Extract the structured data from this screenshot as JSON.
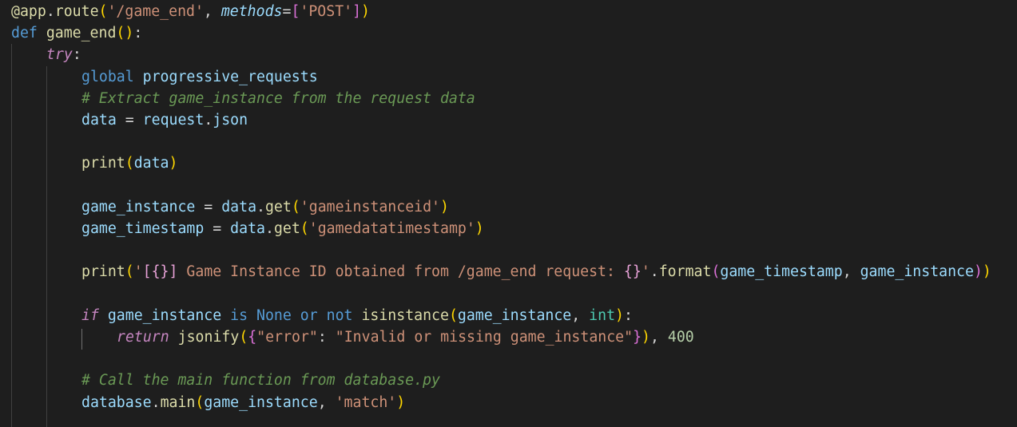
{
  "editor": {
    "theme_background": "#1e1e1e",
    "lines": [
      {
        "indent": 0,
        "tokens": [
          {
            "t": "@app",
            "c": "t-deco"
          },
          {
            "t": ".",
            "c": "t-plain"
          },
          {
            "t": "route",
            "c": "t-deco"
          },
          {
            "t": "(",
            "c": "t-b1"
          },
          {
            "t": "'/game_end'",
            "c": "t-str"
          },
          {
            "t": ", ",
            "c": "t-plain"
          },
          {
            "t": "methods",
            "c": "t-param"
          },
          {
            "t": "=",
            "c": "t-plain"
          },
          {
            "t": "[",
            "c": "t-b2"
          },
          {
            "t": "'POST'",
            "c": "t-str"
          },
          {
            "t": "]",
            "c": "t-b2"
          },
          {
            "t": ")",
            "c": "t-b1"
          }
        ]
      },
      {
        "indent": 0,
        "tokens": [
          {
            "t": "def ",
            "c": "t-kw"
          },
          {
            "t": "game_end",
            "c": "t-fn"
          },
          {
            "t": "()",
            "c": "t-b1"
          },
          {
            "t": ":",
            "c": "t-plain"
          }
        ]
      },
      {
        "indent": 1,
        "tokens": [
          {
            "t": "try",
            "c": "t-ctl"
          },
          {
            "t": ":",
            "c": "t-plain"
          }
        ]
      },
      {
        "indent": 2,
        "tokens": [
          {
            "t": "global ",
            "c": "t-kw"
          },
          {
            "t": "progressive_requests",
            "c": "t-var"
          }
        ]
      },
      {
        "indent": 2,
        "tokens": [
          {
            "t": "# Extract game_instance from the request data",
            "c": "t-cmt"
          }
        ]
      },
      {
        "indent": 2,
        "tokens": [
          {
            "t": "data",
            "c": "t-var"
          },
          {
            "t": " = ",
            "c": "t-plain"
          },
          {
            "t": "request",
            "c": "t-var"
          },
          {
            "t": ".",
            "c": "t-plain"
          },
          {
            "t": "json",
            "c": "t-var"
          }
        ]
      },
      {
        "indent": 2,
        "tokens": []
      },
      {
        "indent": 2,
        "tokens": [
          {
            "t": "print",
            "c": "t-fn"
          },
          {
            "t": "(",
            "c": "t-b1"
          },
          {
            "t": "data",
            "c": "t-var"
          },
          {
            "t": ")",
            "c": "t-b1"
          }
        ]
      },
      {
        "indent": 2,
        "tokens": []
      },
      {
        "indent": 2,
        "tokens": [
          {
            "t": "game_instance",
            "c": "t-var"
          },
          {
            "t": " = ",
            "c": "t-plain"
          },
          {
            "t": "data",
            "c": "t-var"
          },
          {
            "t": ".",
            "c": "t-plain"
          },
          {
            "t": "get",
            "c": "t-fn"
          },
          {
            "t": "(",
            "c": "t-b1"
          },
          {
            "t": "'gameinstanceid'",
            "c": "t-str"
          },
          {
            "t": ")",
            "c": "t-b1"
          }
        ]
      },
      {
        "indent": 2,
        "tokens": [
          {
            "t": "game_timestamp",
            "c": "t-var"
          },
          {
            "t": " = ",
            "c": "t-plain"
          },
          {
            "t": "data",
            "c": "t-var"
          },
          {
            "t": ".",
            "c": "t-plain"
          },
          {
            "t": "get",
            "c": "t-fn"
          },
          {
            "t": "(",
            "c": "t-b1"
          },
          {
            "t": "'gamedatatimestamp'",
            "c": "t-str"
          },
          {
            "t": ")",
            "c": "t-b1"
          }
        ]
      },
      {
        "indent": 2,
        "tokens": []
      },
      {
        "indent": 2,
        "tokens": [
          {
            "t": "print",
            "c": "t-fn"
          },
          {
            "t": "(",
            "c": "t-b1"
          },
          {
            "t": "'",
            "c": "t-str"
          },
          {
            "t": "[{}]",
            "c": "t-strp"
          },
          {
            "t": " Game Instance ID obtained from /game_end request: ",
            "c": "t-str"
          },
          {
            "t": "{}",
            "c": "t-strp"
          },
          {
            "t": "'",
            "c": "t-str"
          },
          {
            "t": ".",
            "c": "t-plain"
          },
          {
            "t": "format",
            "c": "t-fn"
          },
          {
            "t": "(",
            "c": "t-b2"
          },
          {
            "t": "game_timestamp",
            "c": "t-var"
          },
          {
            "t": ", ",
            "c": "t-plain"
          },
          {
            "t": "game_instance",
            "c": "t-var"
          },
          {
            "t": ")",
            "c": "t-b2"
          },
          {
            "t": ")",
            "c": "t-b1"
          }
        ]
      },
      {
        "indent": 2,
        "tokens": []
      },
      {
        "indent": 2,
        "tokens": [
          {
            "t": "if",
            "c": "t-ctl"
          },
          {
            "t": " ",
            "c": "t-plain"
          },
          {
            "t": "game_instance",
            "c": "t-var"
          },
          {
            "t": " is ",
            "c": "t-kw"
          },
          {
            "t": "None",
            "c": "t-const"
          },
          {
            "t": " or not ",
            "c": "t-kw"
          },
          {
            "t": "isinstance",
            "c": "t-fn"
          },
          {
            "t": "(",
            "c": "t-b1"
          },
          {
            "t": "game_instance",
            "c": "t-var"
          },
          {
            "t": ", ",
            "c": "t-plain"
          },
          {
            "t": "int",
            "c": "t-bi"
          },
          {
            "t": ")",
            "c": "t-b1"
          },
          {
            "t": ":",
            "c": "t-plain"
          }
        ]
      },
      {
        "indent": 3,
        "tokens": [
          {
            "t": "return",
            "c": "t-ctl"
          },
          {
            "t": " ",
            "c": "t-plain"
          },
          {
            "t": "jsonify",
            "c": "t-fn"
          },
          {
            "t": "(",
            "c": "t-b1"
          },
          {
            "t": "{",
            "c": "t-b2"
          },
          {
            "t": "\"error\"",
            "c": "t-str"
          },
          {
            "t": ": ",
            "c": "t-plain"
          },
          {
            "t": "\"Invalid or missing game_instance\"",
            "c": "t-str"
          },
          {
            "t": "}",
            "c": "t-b2"
          },
          {
            "t": ")",
            "c": "t-b1"
          },
          {
            "t": ", ",
            "c": "t-plain"
          },
          {
            "t": "400",
            "c": "t-num"
          }
        ]
      },
      {
        "indent": 2,
        "tokens": []
      },
      {
        "indent": 2,
        "tokens": [
          {
            "t": "# Call the main function from database.py",
            "c": "t-cmt"
          }
        ]
      },
      {
        "indent": 2,
        "tokens": [
          {
            "t": "database",
            "c": "t-var"
          },
          {
            "t": ".",
            "c": "t-plain"
          },
          {
            "t": "main",
            "c": "t-fn"
          },
          {
            "t": "(",
            "c": "t-b1"
          },
          {
            "t": "game_instance",
            "c": "t-var"
          },
          {
            "t": ", ",
            "c": "t-plain"
          },
          {
            "t": "'match'",
            "c": "t-str"
          },
          {
            "t": ")",
            "c": "t-b1"
          }
        ]
      },
      {
        "indent": 2,
        "tokens": []
      }
    ]
  }
}
